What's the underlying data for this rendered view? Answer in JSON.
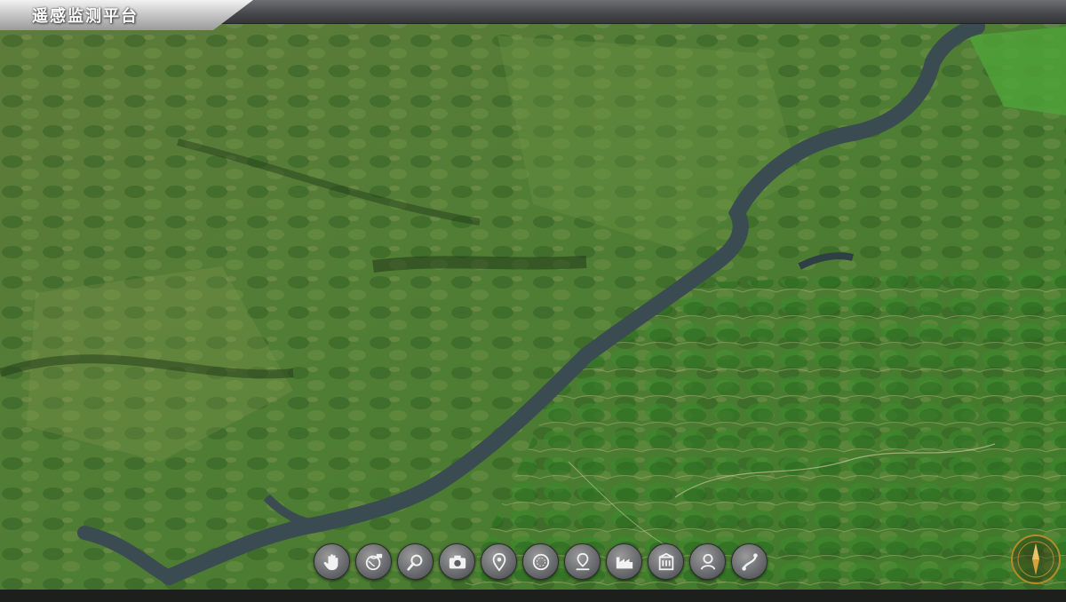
{
  "window": {
    "title": "遥感监测平台"
  },
  "toolbar": {
    "buttons": [
      {
        "icon": "hand-pan-icon"
      },
      {
        "icon": "globe-satellite-icon"
      },
      {
        "icon": "search-icon"
      },
      {
        "icon": "camera-icon"
      },
      {
        "icon": "location-pin-icon"
      },
      {
        "icon": "circle-grid-icon"
      },
      {
        "icon": "pin-marker-icon"
      },
      {
        "icon": "factory-icon"
      },
      {
        "icon": "building-icon"
      },
      {
        "icon": "user-icon"
      },
      {
        "icon": "route-icon"
      }
    ]
  },
  "compass": {
    "icon": "compass-icon"
  },
  "colors": {
    "titlebar": "#45474a",
    "title_tab": "#c9c9c9",
    "button": "#5f6064",
    "compass_ring": "#b48a2a",
    "terrain": "#4f7d34",
    "river": "#3a4b52"
  }
}
